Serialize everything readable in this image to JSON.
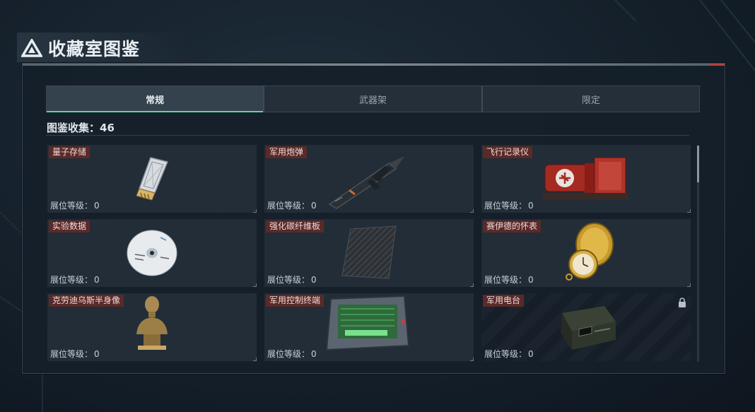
{
  "title": "收藏室图鉴",
  "tabs": [
    {
      "label": "常规",
      "active": true
    },
    {
      "label": "武器架",
      "active": false
    },
    {
      "label": "限定",
      "active": false
    }
  ],
  "collection": {
    "label": "图鉴收集：",
    "count": "46"
  },
  "level_label": "展位等级：",
  "items": [
    {
      "name": "量子存储",
      "level": "0",
      "icon": "usb-drive-icon",
      "locked": false
    },
    {
      "name": "军用炮弹",
      "level": "0",
      "icon": "missile-icon",
      "locked": false
    },
    {
      "name": "飞行记录仪",
      "level": "0",
      "icon": "flight-recorder-icon",
      "locked": false
    },
    {
      "name": "实验数据",
      "level": "0",
      "icon": "disc-icon",
      "locked": false
    },
    {
      "name": "强化碳纤维板",
      "level": "0",
      "icon": "carbon-plate-icon",
      "locked": false
    },
    {
      "name": "赛伊德的怀表",
      "level": "0",
      "icon": "pocket-watch-icon",
      "locked": false
    },
    {
      "name": "克劳迪乌斯半身像",
      "level": "0",
      "icon": "bust-icon",
      "locked": false
    },
    {
      "name": "军用控制终端",
      "level": "0",
      "icon": "control-terminal-icon",
      "locked": false
    },
    {
      "name": "军用电台",
      "level": "0",
      "icon": "radio-icon",
      "locked": true
    }
  ],
  "colors": {
    "accent": "#57d8a3",
    "tag_bg": "#5a2a28",
    "panel": "#16202a"
  }
}
